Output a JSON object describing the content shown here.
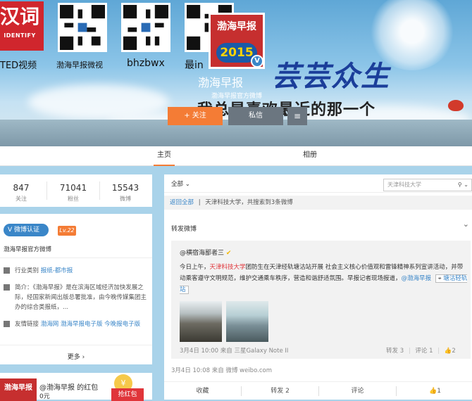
{
  "banner": {
    "logo_left_text": "汉词",
    "logo_left_sub": "IDENTIFY",
    "qr_labels": [
      "TED视频",
      "渤海早报微视",
      "bhzbwx",
      "最in"
    ],
    "avatar_title": "渤海早报",
    "avatar_year": "2015",
    "verified_mark": "V",
    "username": "渤海早报",
    "user_sub": "渤海早报官方微博",
    "slogan_line1": "芸芸众生",
    "slogan_line2": "我总是喜欢最近的那一个",
    "follow_label": "+ 关注",
    "message_label": "私信",
    "more_icon": "≡"
  },
  "tabs": [
    {
      "label": "主页"
    },
    {
      "label": "相册"
    }
  ],
  "stats": [
    {
      "value": "847",
      "label": "关注"
    },
    {
      "value": "71041",
      "label": "粉丝"
    },
    {
      "value": "15543",
      "label": "微博"
    }
  ],
  "profile": {
    "verified_label": "微博认证",
    "level": "Lv.22",
    "verified_desc": "渤海早报官方微博",
    "category_label": "行业类别",
    "category_value": "报纸-都市报",
    "intro_label": "简介：",
    "intro": "《渤海早报》是在滨海区域经济加快发展之际，经国家新闻出版总署批准，由今晚传媒集团主办的综合类报纸，...",
    "links_label": "友情链接",
    "links": [
      "渤海网",
      "渤海早报电子版",
      "今晚报电子版"
    ],
    "more_label": "更多 ›"
  },
  "redpacket": {
    "thumb_text": "渤海早报",
    "text": "@渤海早报 的红包",
    "sub": "0元",
    "grab_label": "抢红包",
    "coin_text": "¥"
  },
  "feed": {
    "filter_label": "全部",
    "search_placeholder": "天津科技大学",
    "back_label": "返回全部",
    "breadcrumb_text": "天津科技大学，共搜索到3条微博",
    "post": {
      "repost_label": "转发微博",
      "original_author": "@横宿海鄙者三",
      "text_before": "今日上午，",
      "text_highlight": "天津科技大学",
      "text_after": "团防生在天津经轨塘沽站开展 社会主义核心价值观和雷锋精神系列宣讲活动，并带动乘客遵守文明规范，维护交通乘车秩序，营造和谐舒适氛围。早报记者现场报道，",
      "mention": "@渤海早报",
      "location": "塘沽轻轨站",
      "orig_date": "3月4日 10:00",
      "orig_from": "来自",
      "orig_device": "三星Galaxy Note II",
      "orig_repost": "转发 3",
      "orig_comment": "评论 1",
      "orig_like": "2",
      "date": "3月4日 10:08",
      "from": "来自",
      "source": "微博 weibo.com",
      "actions": {
        "favorite": "收藏",
        "repost": "转发 2",
        "comment": "评论",
        "like": "1"
      }
    }
  },
  "colors": {
    "accent": "#f47c35",
    "link": "#3a86c8",
    "highlight": "#e0353a"
  }
}
